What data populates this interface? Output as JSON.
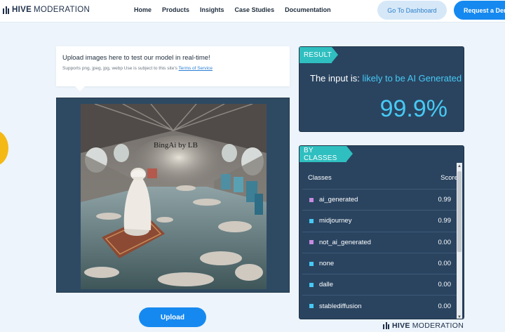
{
  "header": {
    "brand": "HIVE",
    "brand_suffix": "MODERATION",
    "nav": [
      "Home",
      "Products",
      "Insights",
      "Case Studies",
      "Documentation"
    ],
    "dashboard_button": "Go To Dashboard",
    "demo_button": "Request a Demo"
  },
  "upload": {
    "title": "Upload images here to test our model in real-time!",
    "subtitle": "Supports png, jpeg, jpg, webp Use is subject to this site's",
    "terms_link": "Terms of Service",
    "button": "Upload",
    "image_watermark": "BingAi by LB"
  },
  "result": {
    "tag": "RESULT",
    "prefix": "The input is:",
    "verdict": "likely to be AI Generated",
    "value": "99.9%"
  },
  "classes": {
    "tag": "BY CLASSES",
    "header_class": "Classes",
    "header_score": "Score",
    "rows": [
      {
        "name": "ai_generated",
        "score": "0.99",
        "color": "#c78be0"
      },
      {
        "name": "midjourney",
        "score": "0.99",
        "color": "#47c9f4"
      },
      {
        "name": "not_ai_generated",
        "score": "0.00",
        "color": "#c78be0"
      },
      {
        "name": "none",
        "score": "0.00",
        "color": "#47c9f4"
      },
      {
        "name": "dalle",
        "score": "0.00",
        "color": "#47c9f4"
      },
      {
        "name": "stablediffusion",
        "score": "0.00",
        "color": "#47c9f4"
      }
    ]
  },
  "footer": {
    "brand": "HIVE",
    "brand_suffix": "MODERATION"
  },
  "colors": {
    "accent": "#1689f0",
    "panel": "#2a4460",
    "tag": "#2fbfc0",
    "highlight": "#47c9f4"
  }
}
